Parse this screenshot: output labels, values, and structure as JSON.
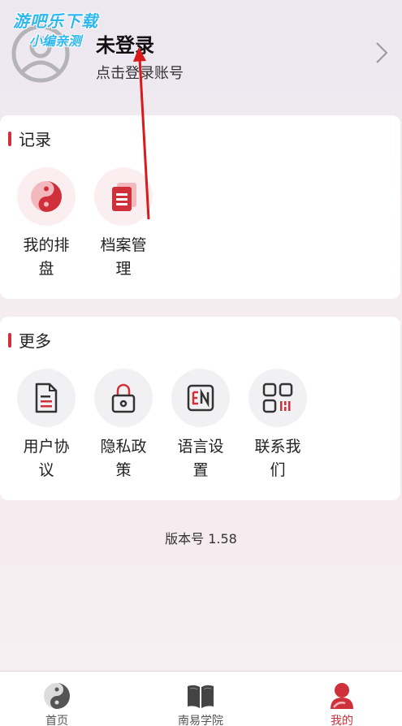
{
  "watermark": {
    "line1": "游吧乐下载",
    "line2": "小编亲测"
  },
  "header": {
    "title": "未登录",
    "subtitle": "点击登录账号",
    "avatar_icon": "user-avatar-icon",
    "chevron_icon": "chevron-right-icon"
  },
  "records": {
    "title": "记录",
    "items": [
      {
        "label": "我的排盘",
        "icon": "yin-yang-icon"
      },
      {
        "label": "档案管理",
        "icon": "archive-icon"
      }
    ]
  },
  "more": {
    "title": "更多",
    "items": [
      {
        "label": "用户协议",
        "icon": "document-icon"
      },
      {
        "label": "隐私政策",
        "icon": "lock-icon"
      },
      {
        "label": "语言设置",
        "icon": "language-en-icon"
      },
      {
        "label": "联系我们",
        "icon": "qr-code-icon"
      }
    ]
  },
  "version": "版本号 1.58",
  "tabbar": {
    "tabs": [
      {
        "label": "首页",
        "icon": "yin-yang-icon"
      },
      {
        "label": "南易学院",
        "icon": "book-icon"
      },
      {
        "label": "我的",
        "icon": "profile-icon",
        "active": true
      }
    ]
  },
  "colors": {
    "accent": "#d0303a",
    "watermark": "#2fb7f0"
  }
}
